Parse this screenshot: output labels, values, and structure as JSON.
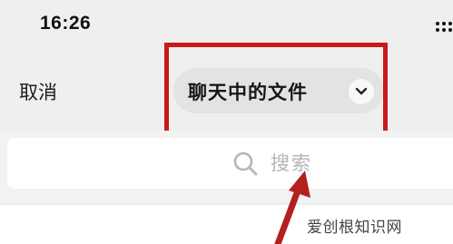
{
  "status_bar": {
    "time": "16:26",
    "signal_icon": "signal-dots-icon"
  },
  "nav": {
    "cancel_label": "取消",
    "title": "聊天中的文件",
    "title_dropdown_icon": "chevron-down-icon"
  },
  "search": {
    "icon": "search-icon",
    "placeholder": "搜索"
  },
  "annotation": {
    "highlight_color": "#c8191d",
    "arrow_color": "#b3201e"
  },
  "watermark": {
    "text": "爱创根知识网"
  }
}
